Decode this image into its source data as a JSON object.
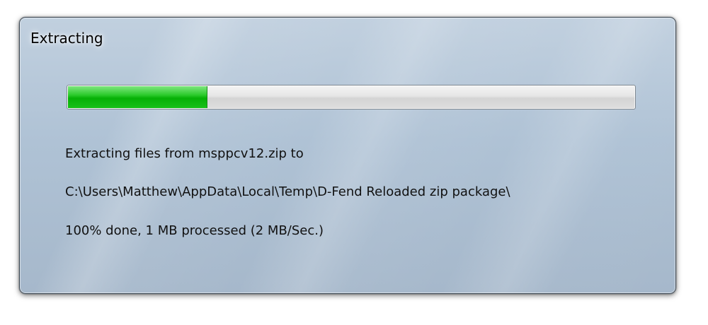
{
  "window": {
    "title": "Extracting"
  },
  "progress": {
    "fraction": 0.245,
    "fill_color": "#06b006"
  },
  "status": {
    "line1": "Extracting files from msppcv12.zip to",
    "line2": "C:\\Users\\Matthew\\AppData\\Local\\Temp\\D-Fend Reloaded zip package\\",
    "line3": "100% done, 1 MB processed (2 MB/Sec.)"
  }
}
